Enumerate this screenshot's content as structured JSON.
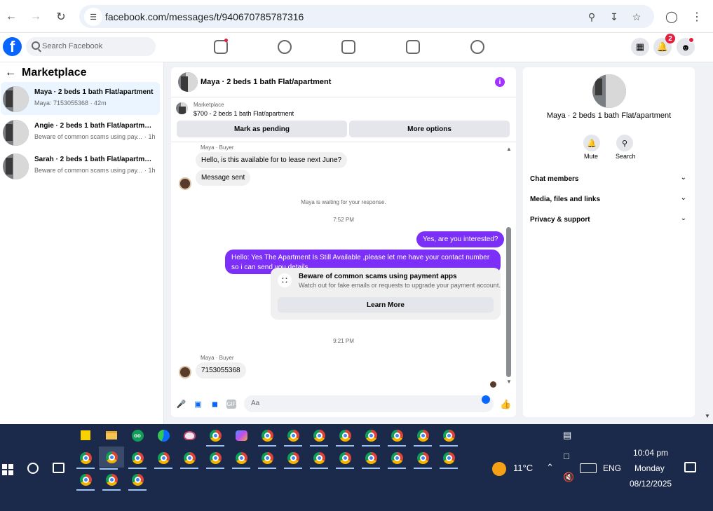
{
  "browser": {
    "url": "facebook.com/messages/t/940670785787316"
  },
  "fb": {
    "search_placeholder": "Search Facebook",
    "notifications_count": "2"
  },
  "left": {
    "title": "Marketplace",
    "threads": [
      {
        "name": "Maya · 2 beds 1 bath Flat/apartment",
        "sub": "Maya: 7153055368 · 42m",
        "time": ""
      },
      {
        "name": "Angie · 2 beds 1 bath Flat/apartme...",
        "sub": "Beware of common scams using pay...",
        "time": "· 1h"
      },
      {
        "name": "Sarah · 2 beds 1 bath Flat/apartment",
        "sub": "Beware of common scams using pay...",
        "time": "· 1h"
      }
    ]
  },
  "chat": {
    "title": "Maya · 2 beds 1 bath Flat/apartment",
    "listing_source": "Marketplace",
    "listing_price": "$700 - 2 beds 1 bath Flat/apartment",
    "btn_pending": "Mark as pending",
    "btn_more": "More options",
    "sender_label_1": "Maya · Buyer",
    "msg_in_1": "Hello, is this available for to lease next June?",
    "msg_in_2": "Message sent",
    "waiting": "Maya is waiting for your response.",
    "time_1": "7:52 PM",
    "msg_out_1": "Yes, are you interested?",
    "msg_out_2_line1": "Hello: Yes The Apartment Is Still Available ,please let me have your contact number",
    "msg_out_2_line2": "so i can send you details",
    "scam_title": "Beware of common scams using payment apps",
    "scam_sub": "Watch out for fake emails or requests to upgrade your payment account.",
    "learn_more": "Learn More",
    "time_2": "9:21 PM",
    "sender_label_2": "Maya · Buyer",
    "msg_in_3": "7153055368",
    "composer_placeholder": "Aa",
    "gif_label": "GIF"
  },
  "right": {
    "title": "Maya · 2 beds 1 bath Flat/apartment",
    "mute": "Mute",
    "search": "Search",
    "rows": [
      "Chat members",
      "Media, files and links",
      "Privacy & support"
    ]
  },
  "taskbar": {
    "temperature": "11°C",
    "lang": "ENG",
    "time": "10:04 pm",
    "day": "Monday",
    "date": "08/12/2025"
  }
}
